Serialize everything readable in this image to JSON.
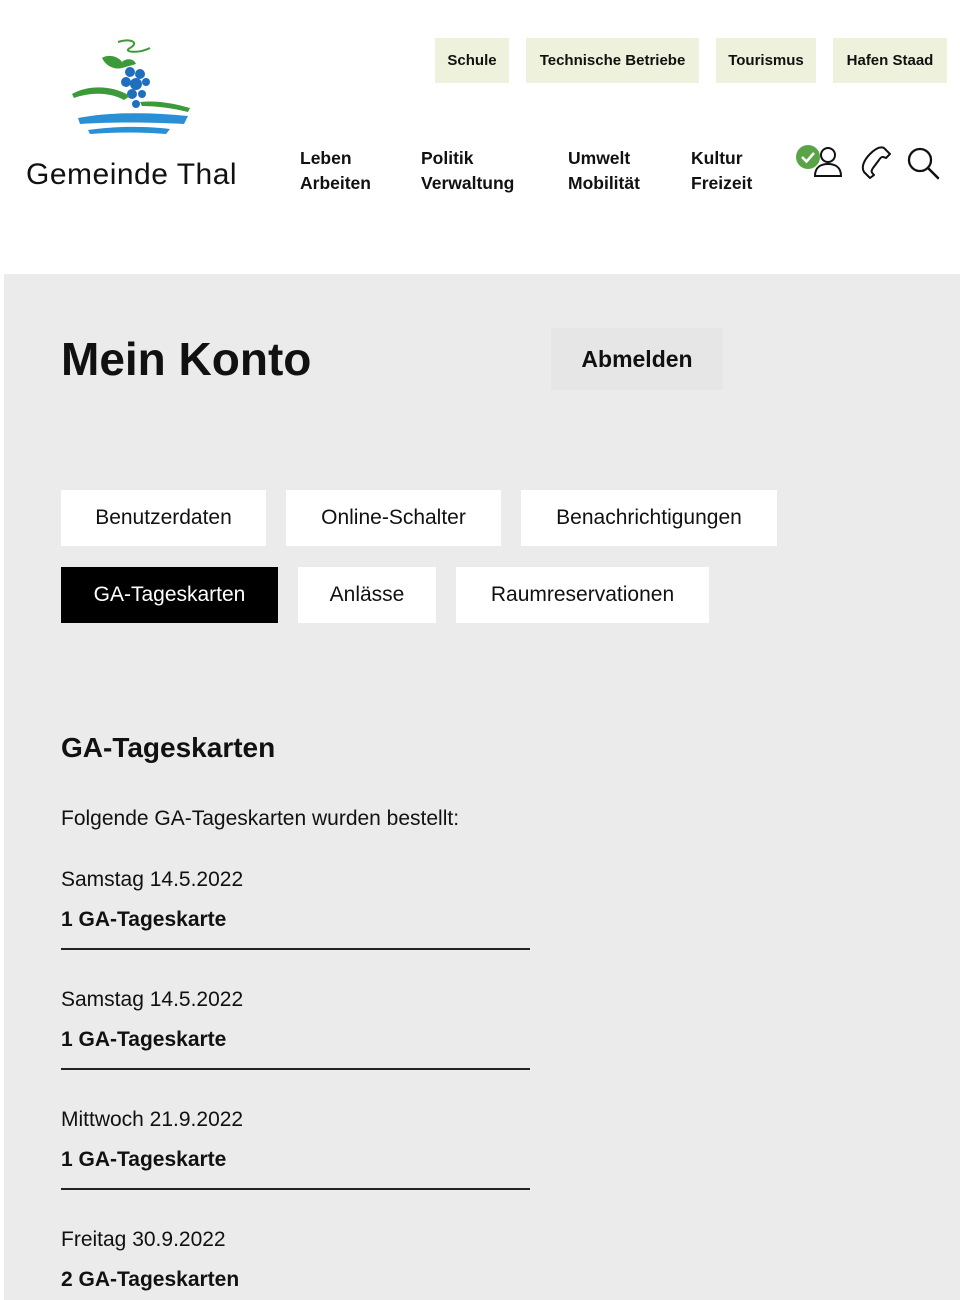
{
  "site": {
    "name": "Gemeinde Thal",
    "logo_icon": "municipality-logo-icon"
  },
  "quick_links": [
    "Schule",
    "Technische Betriebe",
    "Tourismus",
    "Hafen Staad"
  ],
  "main_nav": [
    {
      "line1": "Leben",
      "line2": "Arbeiten"
    },
    {
      "line1": "Politik",
      "line2": "Verwaltung"
    },
    {
      "line1": "Umwelt",
      "line2": "Mobilität"
    },
    {
      "line1": "Kultur",
      "line2": "Freizeit"
    }
  ],
  "header_icons": [
    "user-logged-in-icon",
    "phone-icon",
    "search-icon"
  ],
  "account": {
    "title": "Mein Konto",
    "logout_label": "Abmelden"
  },
  "tabs": [
    {
      "label": "Benutzerdaten",
      "active": false
    },
    {
      "label": "Online-Schalter",
      "active": false
    },
    {
      "label": "Benachrichtigungen",
      "active": false
    },
    {
      "label": "GA-Tageskarten",
      "active": true
    },
    {
      "label": "Anlässe",
      "active": false
    },
    {
      "label": "Raumreservationen",
      "active": false
    }
  ],
  "section": {
    "heading": "GA-Tageskarten",
    "intro": "Folgende GA-Tageskarten wurden bestellt:",
    "orders": [
      {
        "date": "Samstag 14.5.2022",
        "count": "1 GA-Tageskarte"
      },
      {
        "date": "Samstag 14.5.2022",
        "count": "1 GA-Tageskarte"
      },
      {
        "date": "Mittwoch 21.9.2022",
        "count": "1 GA-Tageskarte"
      },
      {
        "date": "Freitag 30.9.2022",
        "count": "2 GA-Tageskarten"
      }
    ]
  },
  "colors": {
    "quick_link_bg": "#eef1dc",
    "content_bg": "#ebebeb",
    "active_tab_bg": "#000000",
    "logo_green": "#3d9a3a",
    "logo_blue": "#1f6fbf",
    "status_green": "#5aa447"
  }
}
